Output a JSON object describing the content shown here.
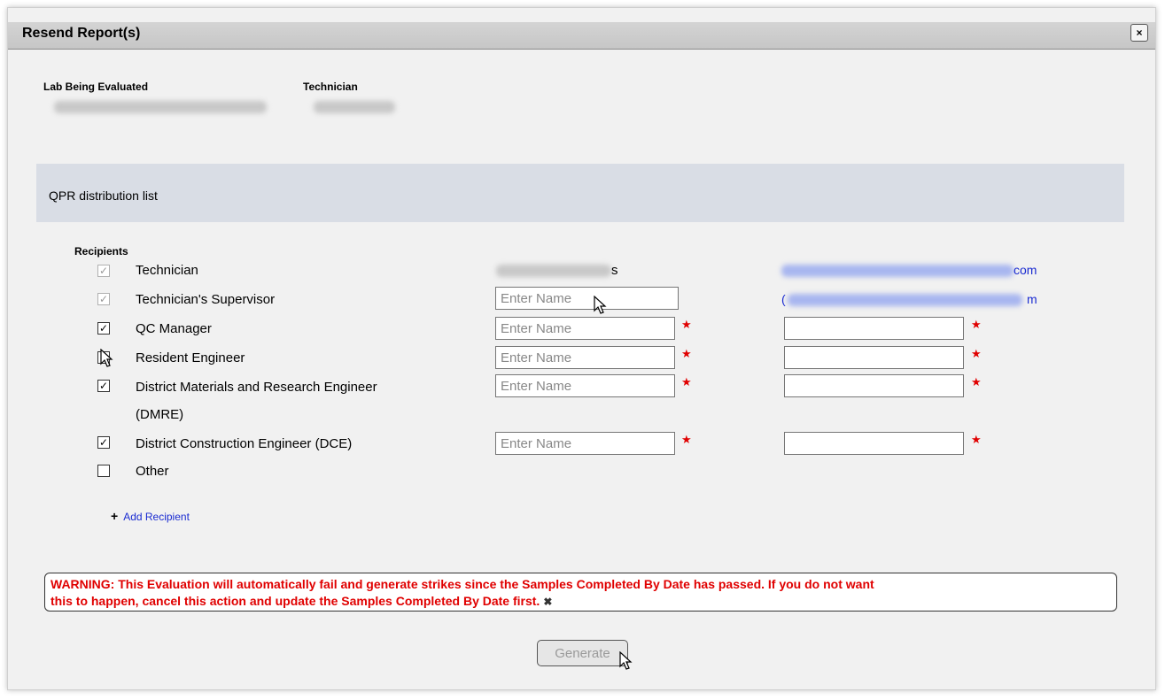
{
  "dialog": {
    "title": "Resend Report(s)",
    "close_icon": "×"
  },
  "info": {
    "lab_label": "Lab Being Evaluated",
    "technician_label": "Technician"
  },
  "section": {
    "title": "QPR distribution list"
  },
  "recipients": {
    "label": "Recipients",
    "rows": [
      {
        "role": "Technician",
        "checked": true,
        "disabled": true,
        "name_suffix": "s",
        "email_suffix": "com"
      },
      {
        "role": "Technician's Supervisor",
        "checked": true,
        "disabled": true,
        "name_placeholder": "Enter Name",
        "email_prefix": "(",
        "email_suffix": "m"
      },
      {
        "role": "QC Manager",
        "checked": true,
        "disabled": false,
        "name_placeholder": "Enter Name"
      },
      {
        "role": "Resident Engineer",
        "checked": true,
        "disabled": false,
        "name_placeholder": "Enter Name"
      },
      {
        "role_line1": "District Materials and Research Engineer",
        "role_line2": "(DMRE)",
        "checked": true,
        "disabled": false,
        "name_placeholder": "Enter Name"
      },
      {
        "role": "District Construction Engineer (DCE)",
        "checked": true,
        "disabled": false,
        "name_placeholder": "Enter Name"
      },
      {
        "role": "Other",
        "checked": false,
        "disabled": false
      }
    ],
    "required_marker": "★",
    "check_mark": "✓"
  },
  "add_recipient": {
    "plus": "+",
    "label": "Add Recipient"
  },
  "warning": {
    "line1": "WARNING: This Evaluation will automatically fail and generate strikes since the Samples Completed By Date has passed. If you do not want",
    "line2": "this to happen, cancel this action and update the Samples Completed By Date first.",
    "close_icon": "✖"
  },
  "generate_button": {
    "label": "Generate"
  }
}
